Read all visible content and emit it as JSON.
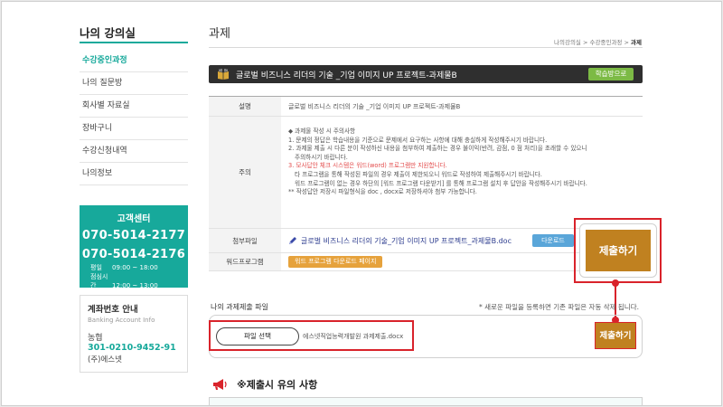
{
  "sidebar": {
    "title": "나의 강의실",
    "items": [
      {
        "label": "수강중인과정",
        "active": true
      },
      {
        "label": "나의 질문방",
        "active": false
      },
      {
        "label": "회사별 자료실",
        "active": false
      },
      {
        "label": "장바구니",
        "active": false
      },
      {
        "label": "수강신청내역",
        "active": false
      },
      {
        "label": "나의정보",
        "active": false
      }
    ],
    "customer_center": {
      "title": "고객센터",
      "phone1": "070-5014-2177",
      "phone2": "070-5014-2176",
      "weekday_label": "평일",
      "weekday_hours": "09:00 ~ 18:00",
      "lunch_label": "점심시간",
      "lunch_hours": "12:00 ~ 13:00"
    },
    "account": {
      "title": "계좌번호 안내",
      "subtitle": "Banking Account Info",
      "bank": "농협",
      "number": "301-0210-9452-91",
      "holder": "(주)에스넷"
    }
  },
  "header": {
    "title": "과제",
    "breadcrumb": [
      "나의강의실",
      "수강중인과정",
      "과제"
    ],
    "breadcrumb_sep": ">"
  },
  "course": {
    "name": "글로벌 비즈니스 리더의 기술 _기업 이미지 UP 프로젝트-과제물B",
    "study_button": "학습방으로"
  },
  "info": {
    "desc_label": "설명",
    "desc_value": "글로벌 비즈니스 리더의 기술 _기업 이미지 UP 프로젝트-과제물B",
    "notice_label": "주의",
    "notice_lines": [
      "◆ 과제물 작성 시 주의사항",
      "1. 문제의 정답은 학습내용을 기준으로 문제에서 요구하는 사항에 대해 충실하게 작성해주시기 바랍니다.",
      "2. 과제물 제출 시 다른 분이 작성하신 내용을 첨부하여 제출하는 경우 불이익(반려, 감점, 0 점 처리)을 초래할 수 있으니",
      "   주의하시기 바랍니다.",
      "3. 모사답안 체크 시스템은 워드(word) 프로그램만 지원합니다.",
      "   타 프로그램을 통해 작성된 파일의 경우 제출이 제한되오니 워드로 작성하여 제출해주시기 바랍니다.",
      "   워드 프로그램이 없는 경우 하단의 [워드 프로그램 다운받기] 를 통해 프로그램 설치 후 답안을 작성해주시기 바랍니다.",
      "** 작성답안 저장시 파일형식을 doc , docx로 저장하셔야 첨부 가능합니다."
    ],
    "attach_label": "첨부파일",
    "attach_file": "글로벌 비즈니스 리더의 기술_기업 이미지 UP 프로젝트_과제물B.doc",
    "download_button": "다운로드",
    "word_label": "워드프로그램",
    "word_button": "워드 프로그램 다운로드 페이지"
  },
  "submit": {
    "big_button": "제출하기",
    "my_file_label": "나의 과제제출 파일",
    "note": "* 새로운 파일을 등록하면 기존 파일은 자동 삭제 됩니다.",
    "file_button": "파일 선택",
    "file_name": "에스넷직업능력개발원 과제제출.docx",
    "small_button": "제출하기"
  },
  "caution": {
    "title": "※제출시 유의 사항"
  },
  "colors": {
    "accent": "#17a99b",
    "highlight": "#d9232b",
    "submit": "#c08120",
    "study": "#7cba45",
    "download": "#5aa6d9",
    "word": "#e6a23c"
  }
}
